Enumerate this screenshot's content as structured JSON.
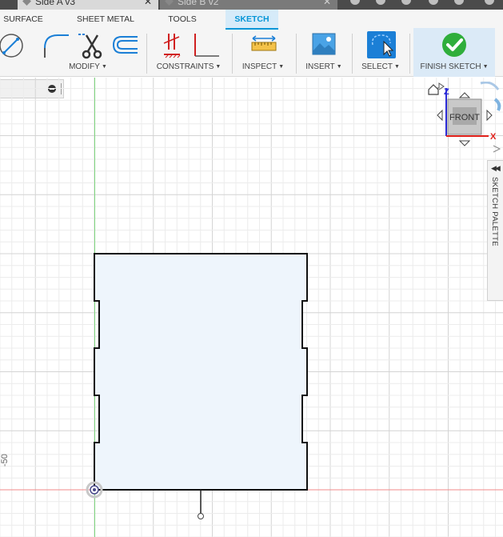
{
  "doc_tabs": [
    {
      "label": "Side A v3",
      "active": true
    },
    {
      "label": "Side B v2",
      "active": false
    }
  ],
  "workspace_tabs": [
    {
      "label": "SURFACE"
    },
    {
      "label": "SHEET METAL"
    },
    {
      "label": "TOOLS"
    },
    {
      "label": "SKETCH",
      "active": true
    }
  ],
  "groups": {
    "modify": {
      "label": "MODIFY",
      "icons": [
        "circle-partial-icon",
        "fillet-icon",
        "trim-scissors-icon",
        "offset-icon"
      ]
    },
    "constraints": {
      "label": "CONSTRAINTS",
      "icons": [
        "parallel-constraint-icon",
        "perpendicular-constraint-icon"
      ]
    },
    "inspect": {
      "label": "INSPECT",
      "icons": [
        "measure-icon"
      ]
    },
    "insert": {
      "label": "INSERT",
      "icons": [
        "insert-image-icon"
      ]
    },
    "select": {
      "label": "SELECT",
      "icons": [
        "select-cursor-icon"
      ]
    },
    "finish": {
      "label": "FINISH SKETCH",
      "icons": [
        "green-checkmark-icon"
      ]
    }
  },
  "viewcube": {
    "face": "FRONT",
    "axis_z": "Z",
    "axis_x": "X",
    "colors": {
      "z": "#2b2bd6",
      "x": "#e0201a"
    }
  },
  "sketch_palette": {
    "label": "SKETCH PALETTE"
  },
  "canvas": {
    "axis_tick_label": "-50",
    "colors": {
      "grid_minor": "#ececec",
      "grid_major": "#d4d4d4",
      "y_axis": "#7fd67f",
      "x_axis": "#f08a8a",
      "profile_fill": "#eef5fc",
      "profile_stroke": "#111111",
      "origin": "#4a4a8a"
    }
  }
}
